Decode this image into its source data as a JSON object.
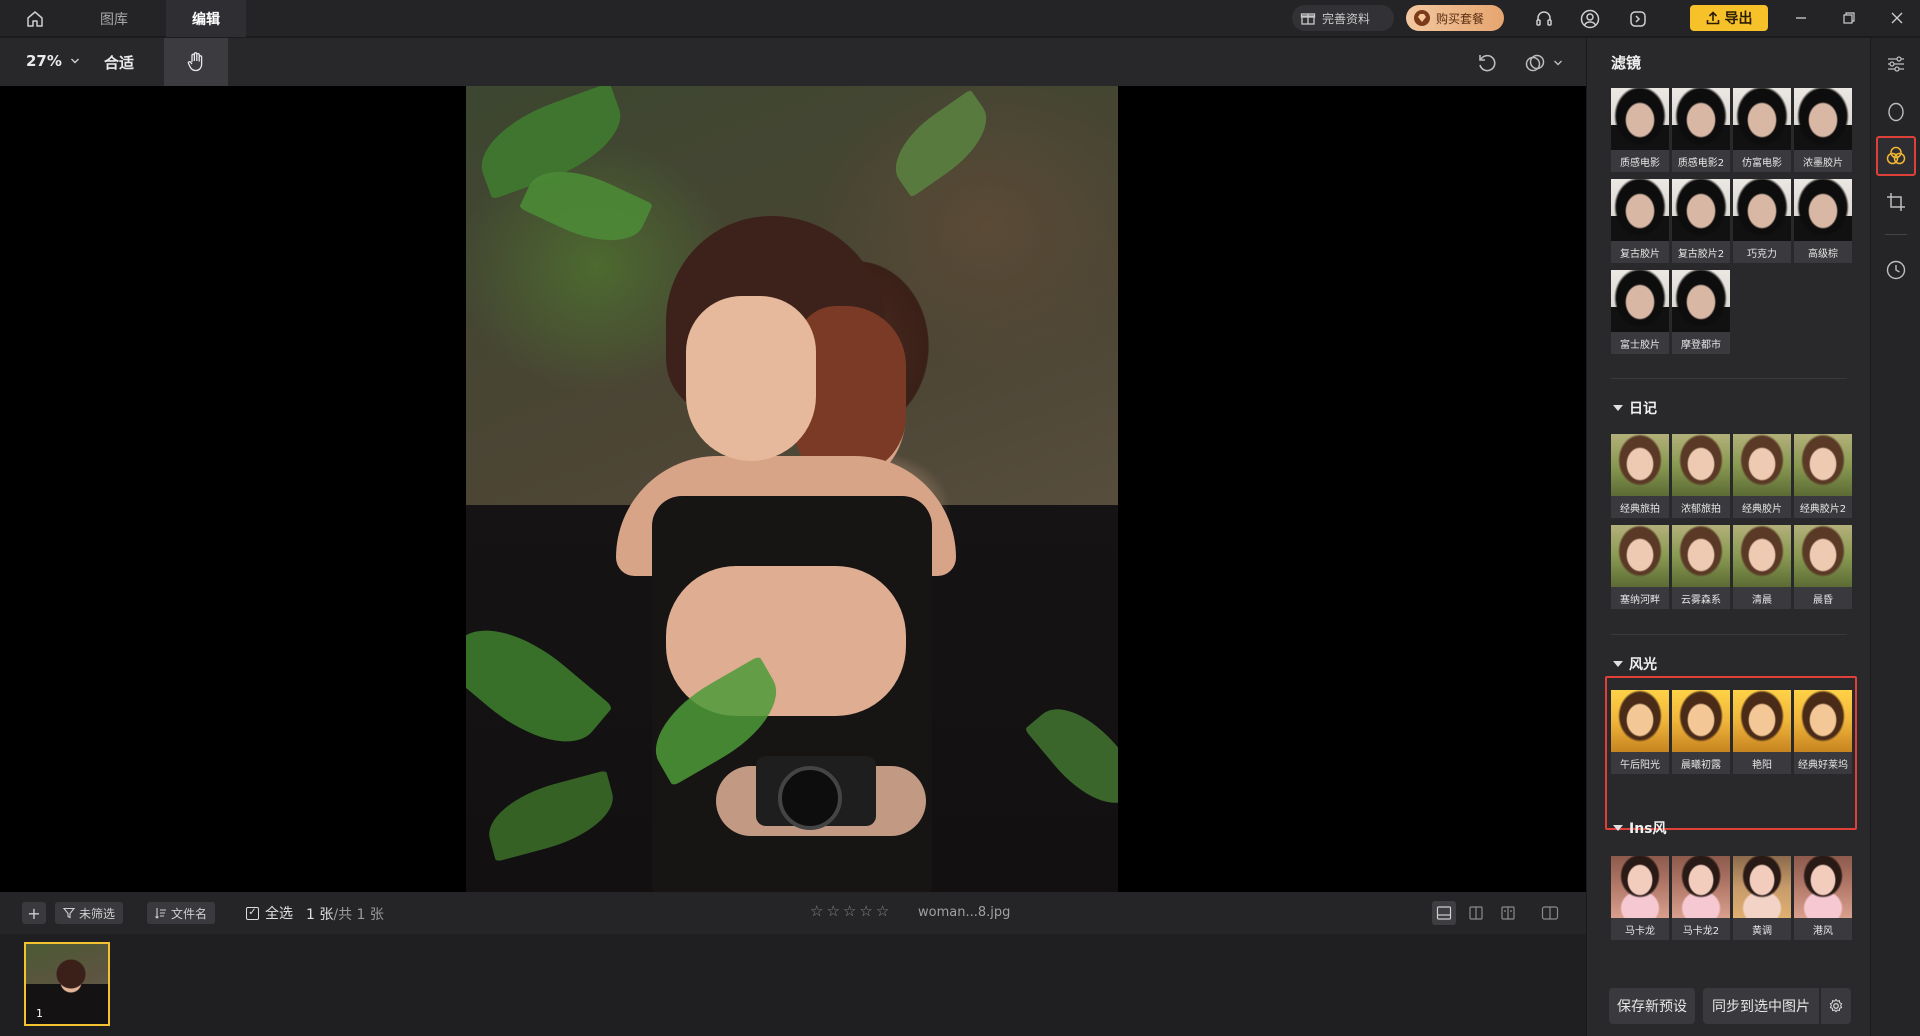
{
  "titlebar": {
    "tabs": [
      {
        "label": "图库",
        "active": false
      },
      {
        "label": "编辑",
        "active": true
      }
    ],
    "complete_info_label": "完善资料",
    "buy_plan_label": "购买套餐",
    "export_label": "导出"
  },
  "toolbar": {
    "zoom_level": "27%",
    "fit_label": "合适"
  },
  "stripbar": {
    "filter_label": "未筛选",
    "sort_label": "文件名",
    "select_all_label": "全选",
    "count_current": "1 张",
    "count_total": "/共 1 张",
    "rating_stars": 0,
    "filename": "woman...8.jpg"
  },
  "filmstrip": {
    "thumb_number": "1"
  },
  "panel": {
    "title": "滤镜",
    "sections": [
      {
        "name": "",
        "filters": [
          "质感电影",
          "质感电影2",
          "仿富电影",
          "浓墨胶片",
          "复古胶片",
          "复古胶片2",
          "巧克力",
          "高级棕",
          "富士胶片",
          "摩登都市"
        ]
      },
      {
        "name": "日记",
        "filters": [
          "经典旅拍",
          "浓郁旅拍",
          "经典胶片",
          "经典胶片2",
          "塞纳河畔",
          "云雾森系",
          "清晨",
          "晨昏"
        ]
      },
      {
        "name": "风光",
        "filters": [
          "午后阳光",
          "晨曦初露",
          "艳阳",
          "经典好莱坞"
        ]
      },
      {
        "name": "Ins风",
        "filters": [
          "马卡龙",
          "马卡龙2",
          "黄调",
          "港风"
        ]
      }
    ],
    "save_preset_label": "保存新预设",
    "sync_label": "同步到选中图片"
  },
  "colors": {
    "accent_yellow": "#f7c12a",
    "highlight_red": "#e0403a",
    "panel_bg": "#29292c"
  }
}
